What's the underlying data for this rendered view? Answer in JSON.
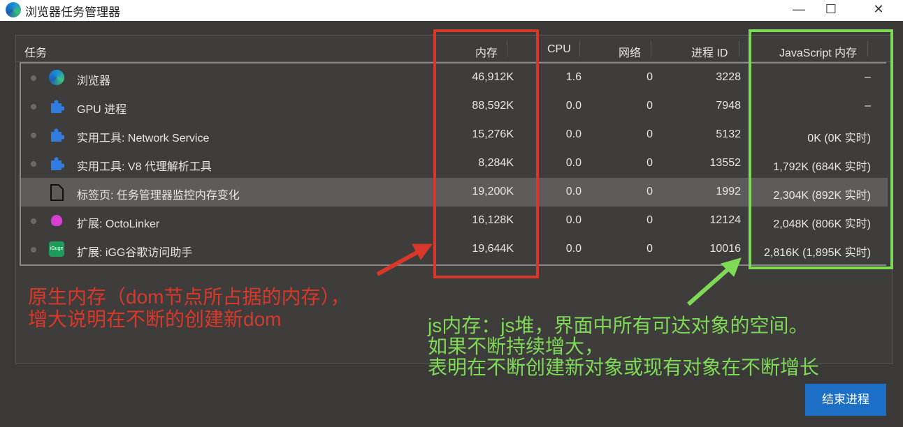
{
  "window": {
    "title": "浏览器任务管理器",
    "minimize": "—",
    "maximize": "☐",
    "close": "✕"
  },
  "headers": {
    "task": "任务",
    "memory": "内存",
    "cpu": "CPU",
    "network": "网络",
    "pid": "进程 ID",
    "js_memory": "JavaScript 内存"
  },
  "rows": [
    {
      "icon": "edge-icon",
      "task": "浏览器",
      "memory": "46,912K",
      "cpu": "1.6",
      "network": "0",
      "pid": "3228",
      "js": "–"
    },
    {
      "icon": "puzzle-icon",
      "task": "GPU 进程",
      "memory": "88,592K",
      "cpu": "0.0",
      "network": "0",
      "pid": "7948",
      "js": "–"
    },
    {
      "icon": "puzzle-icon",
      "task": "实用工具: Network Service",
      "memory": "15,276K",
      "cpu": "0.0",
      "network": "0",
      "pid": "5132",
      "js": "0K (0K 实时)"
    },
    {
      "icon": "puzzle-icon",
      "task": "实用工具: V8 代理解析工具",
      "memory": "8,284K",
      "cpu": "0.0",
      "network": "0",
      "pid": "13552",
      "js": "1,792K (684K 实时)"
    },
    {
      "icon": "page-icon",
      "task": "标签页: 任务管理器监控内存变化",
      "memory": "19,200K",
      "cpu": "0.0",
      "network": "0",
      "pid": "1992",
      "js": "2,304K (892K 实时)"
    },
    {
      "icon": "octolinker-icon",
      "task": "扩展: OctoLinker",
      "memory": "16,128K",
      "cpu": "0.0",
      "network": "0",
      "pid": "12124",
      "js": "2,048K (806K 实时)"
    },
    {
      "icon": "iguge-icon",
      "icon_text": "iGuge",
      "task": "扩展: iGG谷歌访问助手",
      "memory": "19,644K",
      "cpu": "0.0",
      "network": "0",
      "pid": "10016",
      "js": "2,816K (1,895K 实时)"
    }
  ],
  "annotations": {
    "red": [
      "原生内存（dom节点所占据的内存），",
      "增大说明在不断的创建新dom"
    ],
    "green": [
      "js内存：js堆，界面中所有可达对象的空间。",
      "如果不断持续增大，",
      "表明在不断创建新对象或现有对象在不断增长"
    ],
    "red_color": "#d8372a",
    "green_color": "#7ed957"
  },
  "end_button": "结束进程"
}
